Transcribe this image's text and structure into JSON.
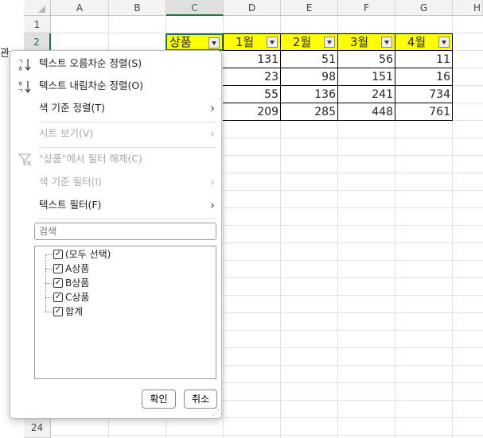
{
  "sheet": {
    "columns": [
      "A",
      "B",
      "C",
      "D",
      "E",
      "F",
      "G",
      "H"
    ],
    "rows": [
      "1",
      "2",
      "24"
    ],
    "left_label": "관",
    "header_row": {
      "c": "상품",
      "d": "1월",
      "e": "2월",
      "f": "3월",
      "g": "4월"
    },
    "data_rows": [
      {
        "d": "131",
        "e": "51",
        "f": "56",
        "g": "11"
      },
      {
        "d": "23",
        "e": "98",
        "f": "151",
        "g": "16"
      },
      {
        "d": "55",
        "e": "136",
        "f": "241",
        "g": "734"
      },
      {
        "d": "209",
        "e": "285",
        "f": "448",
        "g": "761"
      }
    ]
  },
  "menu": {
    "sort_asc": "텍스트 오름차순 정렬(S)",
    "sort_desc": "텍스트 내림차순 정렬(O)",
    "sort_by_color": "색 기준 정렬(T)",
    "sheet_view": "시트 보기(V)",
    "clear_filter": "\"상품\"에서 필터 해제(C)",
    "filter_by_color": "색 기준 필터(I)",
    "text_filter": "텍스트 필터(F)",
    "search_placeholder": "검색",
    "items": [
      "(모두 선택)",
      "A상품",
      "B상품",
      "C상품",
      "합계"
    ],
    "ok": "확인",
    "cancel": "취소"
  }
}
